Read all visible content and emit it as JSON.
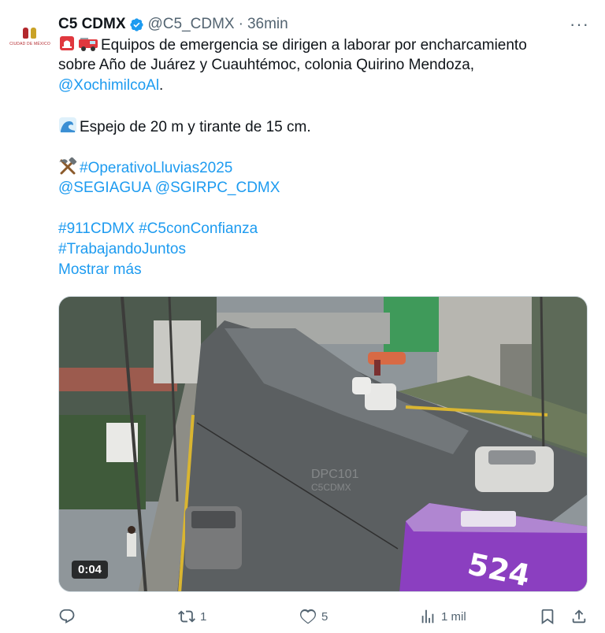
{
  "author": {
    "display_name": "C5 CDMX",
    "handle": "@C5_CDMX",
    "separator": "·",
    "time": "36min",
    "avatar_text": "CIUDAD DE MÉXICO",
    "verified_color": "#1d9bf0"
  },
  "tweet": {
    "line1": "Equipos de emergencia se dirigen a laborar por encharcamiento",
    "line2": "sobre Año de Juárez y Cuauhtémoc, colonia Quirino Mendoza,",
    "mention_xochimilco": "@XochimilcoAl",
    "period": ".",
    "line4": "Espejo de 20 m y tirante de 15 cm.",
    "hashtag_lluvias": "#OperativoLluvias2025",
    "mention_segiagua": "@SEGIAGUA",
    "mention_sgirpc": "@SGIRPC_CDMX",
    "hashtag_911": "#911CDMX",
    "hashtag_c5": "#C5conConfianza",
    "hashtag_trabajando": "#TrabajandoJuntos",
    "show_more": "Mostrar más",
    "emojis": [
      "rotating-light-emoji",
      "fire-engine-emoji",
      "water-wave-emoji",
      "hammer-and-pick-emoji"
    ]
  },
  "media": {
    "duration": "0:04",
    "bus_number": "524",
    "overlay_mark_1": "DPC101",
    "overlay_mark_2": "C5CDMX"
  },
  "actions": {
    "reply_count": "",
    "retweet_count": "1",
    "like_count": "5",
    "views_count": "1 mil"
  },
  "colors": {
    "link": "#1d9bf0",
    "text": "#0f1419",
    "muted": "#536471",
    "bus": "#8b3fc0"
  }
}
